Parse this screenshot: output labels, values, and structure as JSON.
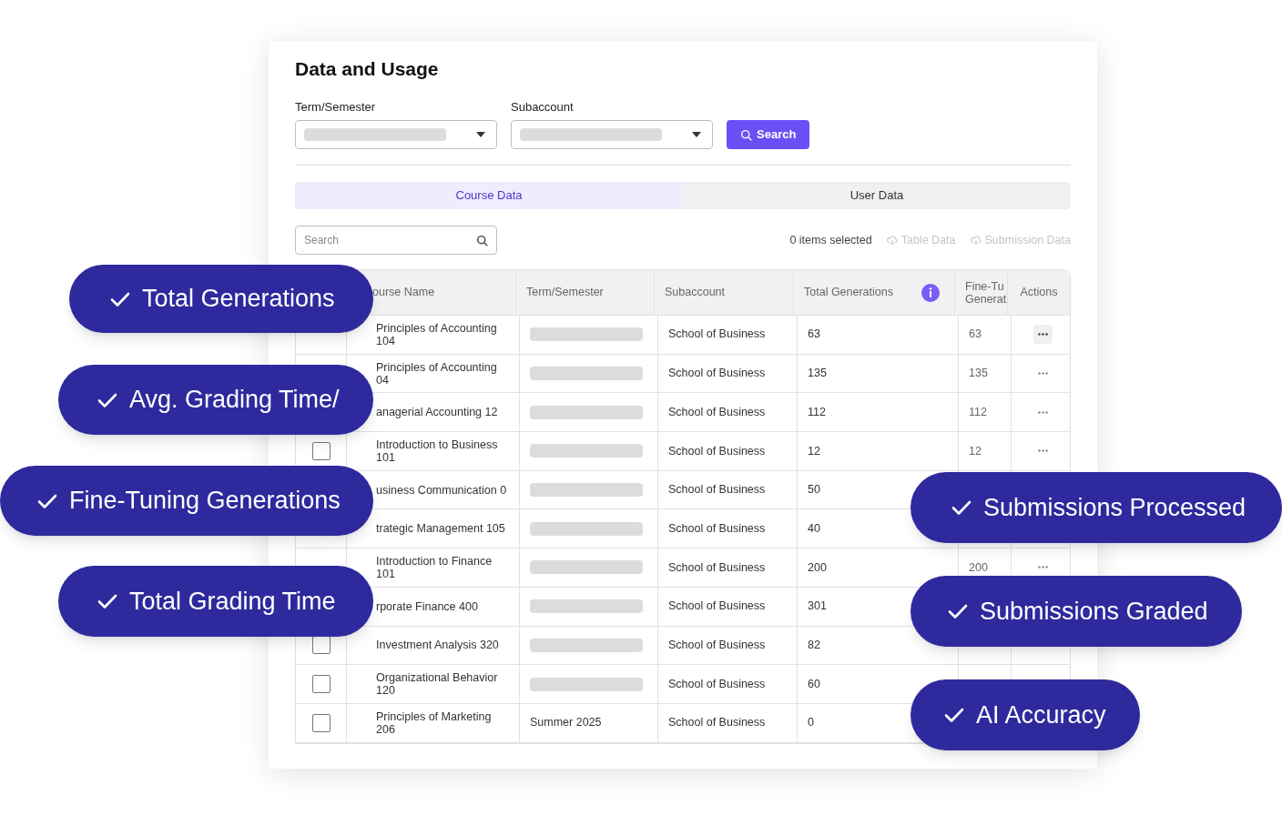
{
  "page": {
    "title": "Data and Usage"
  },
  "filters": [
    {
      "label": "Term/Semester"
    },
    {
      "label": "Subaccount"
    }
  ],
  "search_button": {
    "label": "Search"
  },
  "tabs": [
    {
      "label": "Course Data",
      "selected": true
    },
    {
      "label": "User Data",
      "selected": false
    }
  ],
  "table_search": {
    "placeholder": "Search"
  },
  "selection_count": "0 items selected",
  "downloads": [
    {
      "label": "Table Data",
      "disabled": true
    },
    {
      "label": "Submission Data",
      "disabled": true
    }
  ],
  "table": {
    "columns": [
      "ourse Name",
      "Term/Semester",
      "Subaccount",
      "Total Generations",
      "Fine-Tu Generat",
      "Actions"
    ],
    "rows": [
      {
        "course": "Principles of Accounting 104",
        "subaccount": "School of Business",
        "total": "63",
        "fine_tuning": "63",
        "highlighted": true
      },
      {
        "course": "Principles of Accounting 04",
        "subaccount": "School of Business",
        "total": "135",
        "fine_tuning": "135",
        "highlighted": false
      },
      {
        "course": "anagerial Accounting 12",
        "subaccount": "School of Business",
        "total": "112",
        "fine_tuning": "112",
        "highlighted": false
      },
      {
        "checked": false,
        "course": "Introduction to Business 101",
        "subaccount": "School of Business",
        "total": "12",
        "fine_tuning": "12",
        "highlighted": false
      },
      {
        "course": "usiness Communication 0",
        "subaccount": "School of Business",
        "total": "50"
      },
      {
        "course": "trategic Management 105",
        "subaccount": "School of Business",
        "total": "40"
      },
      {
        "course": "Introduction to Finance 101",
        "subaccount": "School of Business",
        "total": "200",
        "fine_tuning": "200",
        "highlighted": false
      },
      {
        "course": "rporate Finance 400",
        "subaccount": "School of Business",
        "total": "301"
      },
      {
        "checked": false,
        "course": "Investment Analysis 320",
        "subaccount": "School of Business",
        "total": "82"
      },
      {
        "checked": false,
        "course": "Organizational Behavior 120",
        "subaccount": "School of Business",
        "total": "60"
      },
      {
        "checked": false,
        "course": "Principles of Marketing 206",
        "term": "Summer 2025",
        "subaccount": "School of Business",
        "total": "0"
      }
    ]
  },
  "features_left": [
    "Total Generations",
    "Avg. Grading Time/",
    "Fine-Tuning Generations",
    "Total Grading Time"
  ],
  "features_right": [
    "Submissions Processed",
    "Submissions Graded",
    "AI Accuracy"
  ]
}
